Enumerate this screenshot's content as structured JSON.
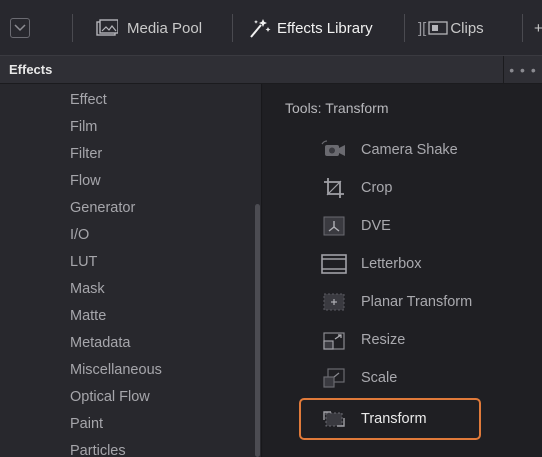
{
  "toolbar": {
    "media_pool": "Media Pool",
    "effects_library": "Effects Library",
    "clips": "Clips",
    "clips_prefix": "][",
    "plus": "+"
  },
  "effects_panel": {
    "title": "Effects",
    "more": "• • •"
  },
  "categories": [
    "Effect",
    "Film",
    "Filter",
    "Flow",
    "Generator",
    "I/O",
    "LUT",
    "Mask",
    "Matte",
    "Metadata",
    "Miscellaneous",
    "Optical Flow",
    "Paint",
    "Particles"
  ],
  "tools": {
    "title": "Tools: Transform",
    "items": [
      {
        "label": "Camera Shake",
        "icon": "camera-shake-icon"
      },
      {
        "label": "Crop",
        "icon": "crop-icon"
      },
      {
        "label": "DVE",
        "icon": "dve-icon"
      },
      {
        "label": "Letterbox",
        "icon": "letterbox-icon"
      },
      {
        "label": "Planar Transform",
        "icon": "planar-transform-icon"
      },
      {
        "label": "Resize",
        "icon": "resize-icon"
      },
      {
        "label": "Scale",
        "icon": "scale-icon"
      },
      {
        "label": "Transform",
        "icon": "transform-icon",
        "selected": true
      }
    ]
  },
  "colors": {
    "highlight": "#e07a3a",
    "background": "#1e1e22"
  }
}
